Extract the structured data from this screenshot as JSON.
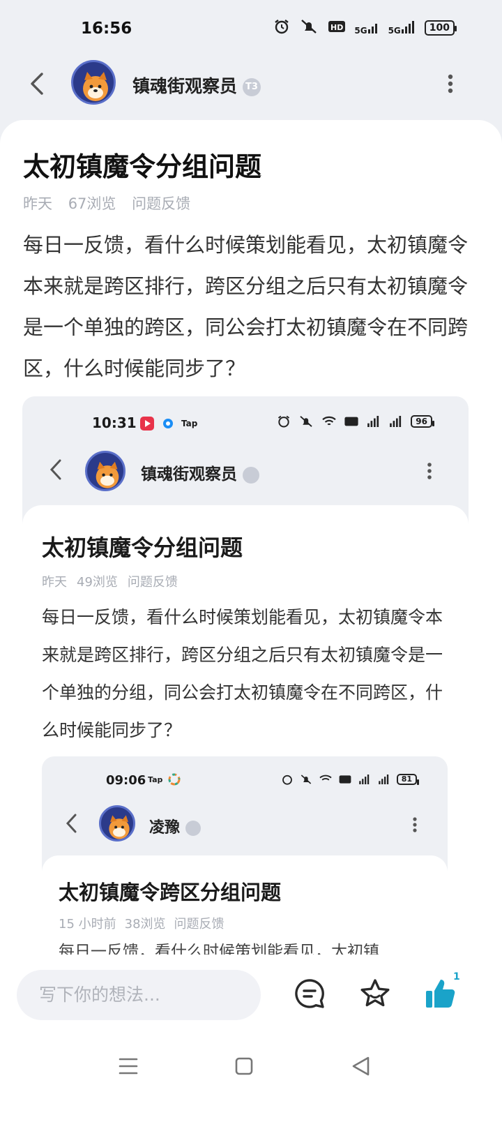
{
  "status": {
    "time": "16:56",
    "network1": "5G",
    "network2": "5G",
    "battery": "100"
  },
  "header": {
    "username": "镇魂街观察员",
    "level_badge": "T3"
  },
  "post": {
    "title": "太初镇魔令分组问题",
    "date": "昨天",
    "views": "67浏览",
    "category": "问题反馈",
    "body": "每日一反馈，看什么时候策划能看见，太初镇魔令本来就是跨区排行，跨区分组之后只有太初镇魔令是一个单独的跨区，同公会打太初镇魔令在不同跨区，什么时候能同步了？"
  },
  "screenshot1": {
    "time": "10:31",
    "app_label": "Tap",
    "battery": "96",
    "username": "镇魂街观察员",
    "title": "太初镇魔令分组问题",
    "date": "昨天",
    "views": "49浏览",
    "category": "问题反馈",
    "body": "每日一反馈，看什么时候策划能看见，太初镇魔令本来就是跨区排行，跨区分组之后只有太初镇魔令是一个单独的分组，同公会打太初镇魔令在不同跨区，什么时候能同步了？"
  },
  "screenshot2": {
    "time": "09:06",
    "app_label": "Tap",
    "battery": "81",
    "username": "凌豫",
    "title": "太初镇魔令跨区分组问题",
    "date": "15 小时前",
    "views": "38浏览",
    "category": "问题反馈",
    "body_partial": "每日一反馈，看什么时候策划能看见，太初镇"
  },
  "bottom": {
    "comment_placeholder": "写下你的想法...",
    "like_count": "1"
  },
  "colors": {
    "accent": "#1aa3c9",
    "muted": "#a8acb4"
  }
}
